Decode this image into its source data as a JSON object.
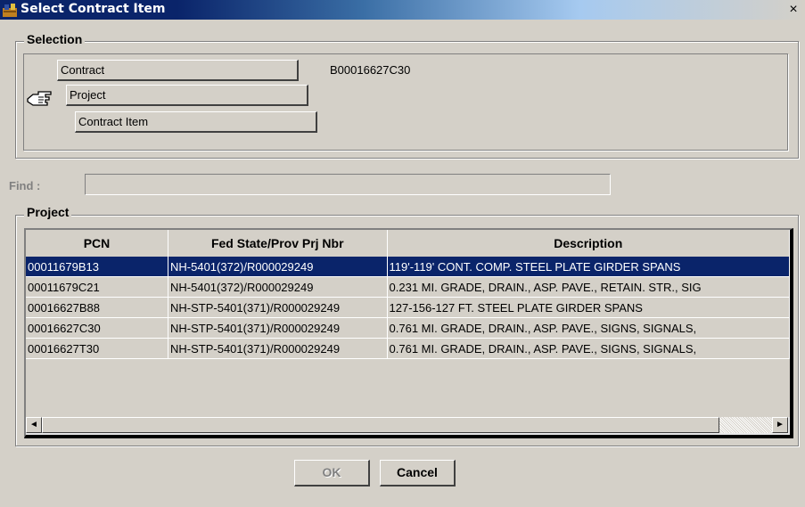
{
  "window": {
    "title": "Select Contract Item",
    "close_glyph": "×",
    "icon": "app-icon"
  },
  "selection": {
    "legend": "Selection",
    "levels": [
      {
        "label": "Contract"
      },
      {
        "label": "Project"
      },
      {
        "label": "Contract Item"
      }
    ],
    "contract_value": "B00016627C30",
    "pointer_icon": "hand-pointer-icon",
    "current_level": "Project"
  },
  "find": {
    "label": "Find :",
    "value": ""
  },
  "project": {
    "legend": "Project",
    "columns": [
      "PCN",
      "Fed State/Prov Prj Nbr",
      "Description"
    ],
    "rows": [
      {
        "pcn": "00011679B13",
        "fed": "NH-5401(372)/R000029249",
        "desc": "119'-119' CONT. COMP. STEEL PLATE GIRDER SPANS",
        "selected": true
      },
      {
        "pcn": "00011679C21",
        "fed": "NH-5401(372)/R000029249",
        "desc": "0.231 MI. GRADE, DRAIN., ASP. PAVE., RETAIN. STR., SIG",
        "selected": false
      },
      {
        "pcn": "00016627B88",
        "fed": "NH-STP-5401(371)/R000029249",
        "desc": "127-156-127 FT. STEEL PLATE GIRDER SPANS",
        "selected": false
      },
      {
        "pcn": "00016627C30",
        "fed": "NH-STP-5401(371)/R000029249",
        "desc": "0.761 MI. GRADE, DRAIN., ASP. PAVE., SIGNS, SIGNALS,",
        "selected": false
      },
      {
        "pcn": "00016627T30",
        "fed": "NH-STP-5401(371)/R000029249",
        "desc": "0.761 MI. GRADE, DRAIN., ASP. PAVE., SIGNS, SIGNALS,",
        "selected": false
      }
    ]
  },
  "scrollbar": {
    "left_arrow": "◄",
    "right_arrow": "►"
  },
  "buttons": {
    "ok": "OK",
    "ok_enabled": false,
    "cancel": "Cancel"
  },
  "colors": {
    "window_bg": "#d4d0c8",
    "title_active": "#0a246a",
    "selection_highlight": "#0a246a"
  }
}
